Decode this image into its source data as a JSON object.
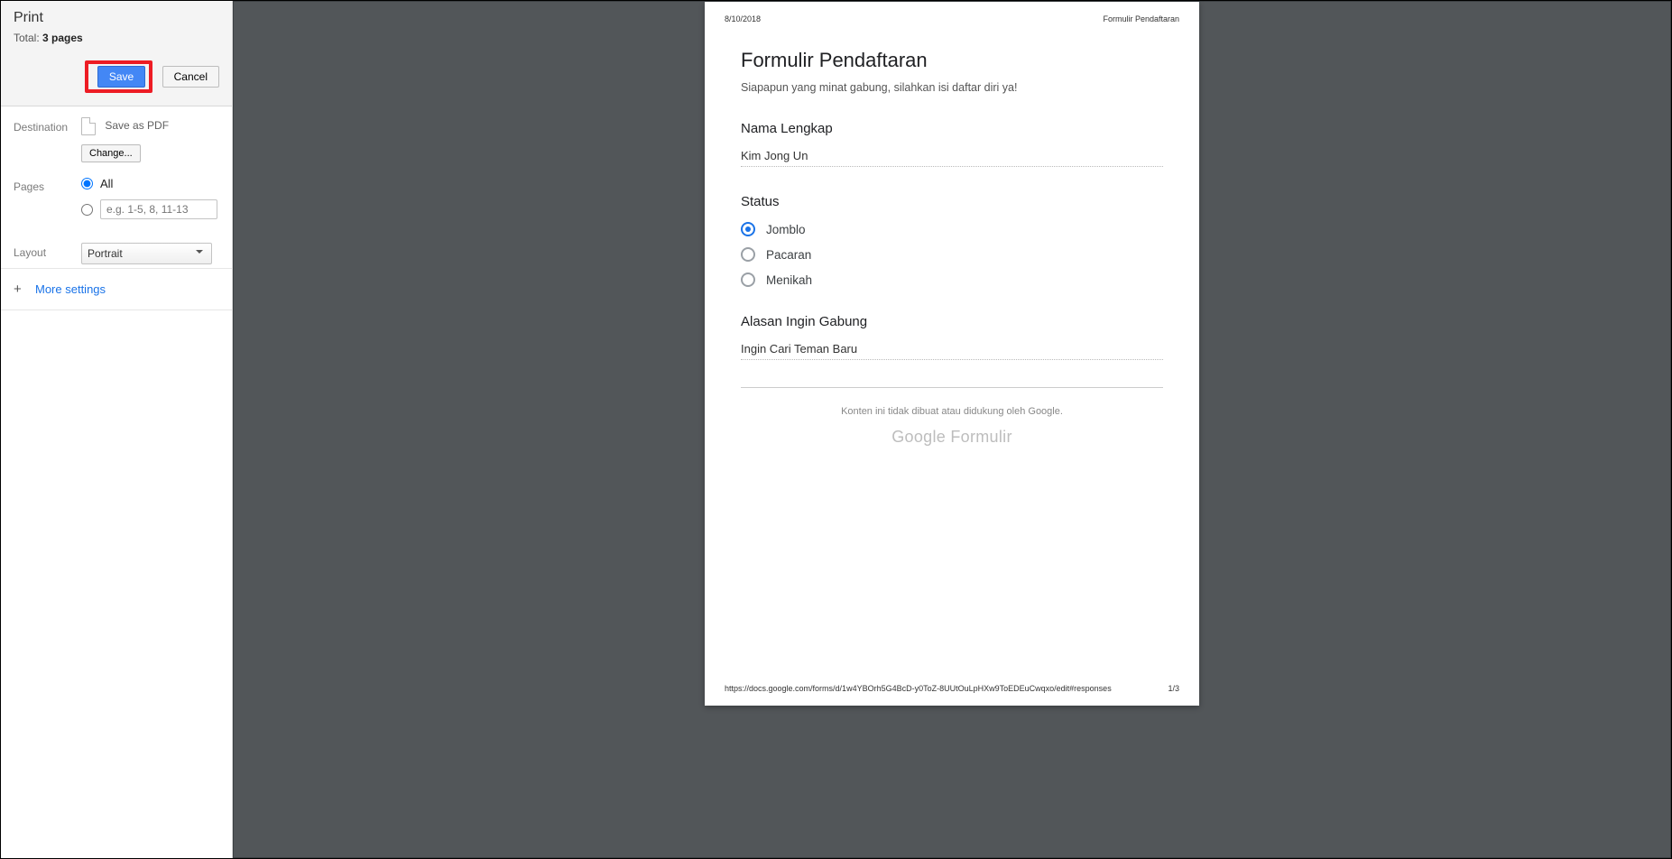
{
  "panel": {
    "title": "Print",
    "total_prefix": "Total: ",
    "total_value": "3 pages",
    "save_label": "Save",
    "cancel_label": "Cancel",
    "destination_label": "Destination",
    "save_as_pdf": "Save as PDF",
    "change_label": "Change...",
    "pages_label": "Pages",
    "pages_all": "All",
    "pages_placeholder": "e.g. 1-5, 8, 11-13",
    "layout_label": "Layout",
    "layout_value": "Portrait",
    "more_settings": "More settings"
  },
  "preview": {
    "date": "8/10/2018",
    "doc_title": "Formulir Pendaftaran",
    "form_title": "Formulir Pendaftaran",
    "form_desc": "Siapapun yang minat gabung, silahkan isi daftar diri ya!",
    "q1_label": "Nama Lengkap",
    "q1_answer": "Kim Jong Un",
    "q2_label": "Status",
    "q2_opts": [
      "Jomblo",
      "Pacaran",
      "Menikah"
    ],
    "q2_selected": 0,
    "q3_label": "Alasan Ingin Gabung",
    "q3_answer": "Ingin Cari Teman Baru",
    "google_note": "Konten ini tidak dibuat atau didukung oleh Google.",
    "google_forms_a": "Google",
    "google_forms_b": " Formulir",
    "footer_url": "https://docs.google.com/forms/d/1w4YBOrh5G4BcD-y0ToZ-8UUtOuLpHXw9ToEDEuCwqxo/edit#responses",
    "footer_page": "1/3"
  }
}
